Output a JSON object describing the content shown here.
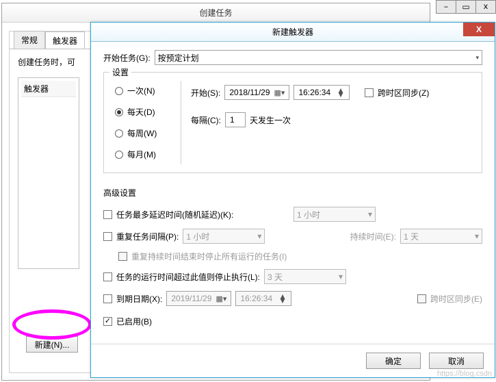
{
  "parent_controls": {
    "minimize": "–",
    "maximize": "▭",
    "close": "x"
  },
  "host": {
    "title": "创建任务",
    "tabs": {
      "general": "常规",
      "triggers": "触发器"
    },
    "hint": "创建任务时，可",
    "triggers_header": "触发器",
    "new_button": "新建(N)..."
  },
  "dialog": {
    "title": "新建触发器",
    "close": "X",
    "begin_task_label": "开始任务(G):",
    "begin_task_value": "按预定计划",
    "settings_legend": "设置",
    "radios": {
      "once": "一次(N)",
      "daily": "每天(D)",
      "weekly": "每周(W)",
      "monthly": "每月(M)"
    },
    "start_label": "开始(S):",
    "start_date": "2018/11/29",
    "start_time": "16:26:34",
    "sync_tz": "跨时区同步(Z)",
    "recur_label": "每隔(C):",
    "recur_value": "1",
    "recur_suffix": "天发生一次",
    "advanced_legend": "高级设置",
    "adv": {
      "delay_label": "任务最多延迟时间(随机延迟)(K):",
      "delay_value": "1 小时",
      "repeat_label": "重复任务间隔(P):",
      "repeat_value": "1 小时",
      "duration_label": "持续时间(E):",
      "duration_value": "1 天",
      "stop_at_end": "重复持续时间结束时停止所有运行的任务(I)",
      "stop_if_longer_label": "任务的运行时间超过此值则停止执行(L):",
      "stop_if_longer_value": "3 天",
      "expire_label": "到期日期(X):",
      "expire_date": "2019/11/29",
      "expire_time": "16:26:34",
      "expire_sync": "跨时区同步(E)",
      "enabled_label": "已启用(B)"
    },
    "ok": "确定",
    "cancel": "取消"
  },
  "watermark": "https://blog.csdn"
}
